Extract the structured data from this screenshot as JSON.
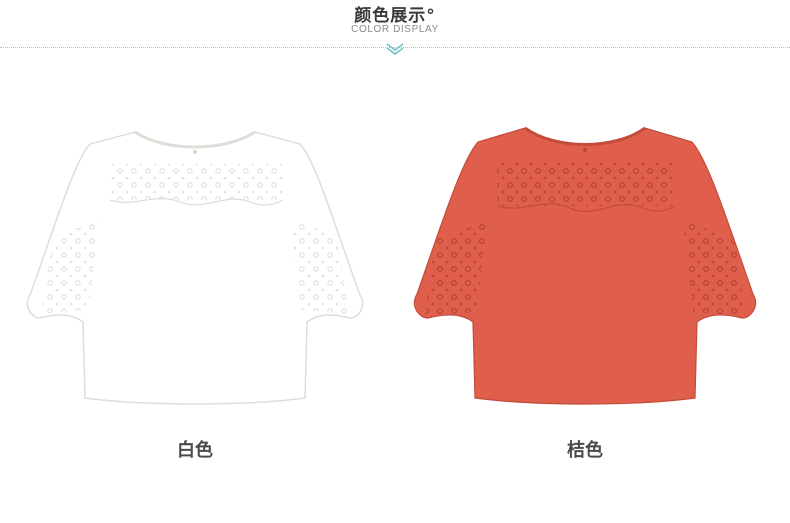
{
  "header": {
    "title": "颜色展示°",
    "subtitle": "COLOR DISPLAY"
  },
  "products": [
    {
      "label": "白色",
      "color": "#ffffff"
    },
    {
      "label": "桔色",
      "color": "#e05f4c"
    }
  ]
}
